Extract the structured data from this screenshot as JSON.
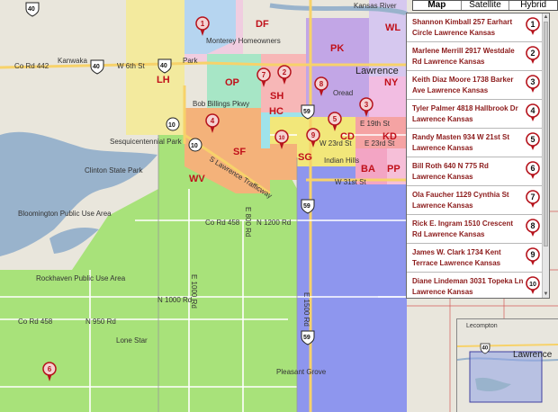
{
  "map_type": {
    "options": [
      "Map",
      "Satellite",
      "Hybrid"
    ],
    "selected": "Map"
  },
  "regions": [
    {
      "code": "DF"
    },
    {
      "code": "WL"
    },
    {
      "code": "LH"
    },
    {
      "code": "OP"
    },
    {
      "code": "SH"
    },
    {
      "code": "PK"
    },
    {
      "code": "NY"
    },
    {
      "code": "HC"
    },
    {
      "code": "CD"
    },
    {
      "code": "KD"
    },
    {
      "code": "SF"
    },
    {
      "code": "SG"
    },
    {
      "code": "BA"
    },
    {
      "code": "PP"
    },
    {
      "code": "WV"
    }
  ],
  "places": {
    "monterey": "Monterey Homeowners",
    "kansas_river": "Kansas River",
    "kanwaka": "Kanwaka",
    "lawrence": "Lawrence",
    "oread": "Oread",
    "sesquicentennial": "Sesquicentennial Park",
    "clinton": "Clinton State Park",
    "bloomington": "Bloomington Public Use Area",
    "rockhaven": "Rockhaven Public Use Area",
    "lone_star": "Lone Star",
    "pleasant_grove": "Pleasant Grove",
    "indian_hills": "Indian Hills",
    "bob_billings": "Bob Billings Pkwy",
    "park": "Park",
    "lecompton": "Lecompton",
    "lawrence_inset": "Lawrence"
  },
  "roads": {
    "co_rd_442": "Co Rd 442",
    "w_6th": "W 6th St",
    "w_23rd": "W 23rd St",
    "w_31st": "W 31st St",
    "e_19th": "E 19th St",
    "e_23rd": "E 23rd St",
    "clinton_trafficway": "S Lawrence Trafficway",
    "co_rd_458_a": "Co Rd 458",
    "n_1200": "N 1200 Rd",
    "co_rd_458_b": "Co Rd 458",
    "n_950": "N 950 Rd",
    "n_1000": "N 1000 Rd",
    "e_1000": "E 1000 Rd",
    "e_800": "E 800 Rd",
    "e_1500": "E 1500 Rd"
  },
  "shields": {
    "i40_top": "40",
    "us40_w": "40",
    "us40_mid": "40",
    "k10_a": "10",
    "k10_b": "10",
    "us59_a": "59",
    "us59_b": "59",
    "us59_c": "59",
    "i40_inset": "40"
  },
  "listings": [
    {
      "num": "1",
      "text": "Shannon Kimball 257 Earhart Circle Lawrence Kansas"
    },
    {
      "num": "2",
      "text": "Marlene Merrill 2917 Westdale Rd Lawrence Kansas"
    },
    {
      "num": "3",
      "text": "Keith Diaz Moore 1738 Barker Ave Lawrence Kansas"
    },
    {
      "num": "4",
      "text": "Tyler Palmer 4818 Hallbrook Dr Lawrence Kansas"
    },
    {
      "num": "5",
      "text": "Randy Masten 934 W 21st St Lawrence Kansas"
    },
    {
      "num": "6",
      "text": "Bill Roth 640 N 775 Rd Lawrence Kansas"
    },
    {
      "num": "7",
      "text": "Ola Faucher 1129 Cynthia St Lawrence Kansas"
    },
    {
      "num": "8",
      "text": "Rick E. Ingram 1510 Crescent Rd Lawrence Kansas"
    },
    {
      "num": "9",
      "text": "James W. Clark 1734 Kent Terrace Lawrence Kansas"
    },
    {
      "num": "10",
      "text": "Diane Lindeman 3031 Topeka Ln Lawrence Kansas"
    }
  ],
  "colors": {
    "marker": "#b5121b",
    "label_red": "#c0101a",
    "listing_text": "#8b1a1a",
    "green_zone": "#a8e27a",
    "blue_zone": "#8e96ee",
    "yellow_zone": "#f3ea9e",
    "orange_zone": "#f4b27a",
    "water": "#99b3cc"
  }
}
